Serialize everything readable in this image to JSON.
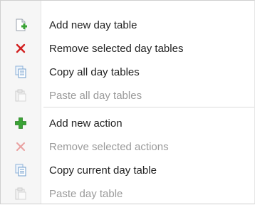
{
  "menu": {
    "items": [
      {
        "label": "Add new day table",
        "icon": "add-document-icon",
        "enabled": true
      },
      {
        "label": "Remove selected day tables",
        "icon": "red-x-icon",
        "enabled": true
      },
      {
        "label": "Copy all day tables",
        "icon": "copy-icon",
        "enabled": true
      },
      {
        "label": "Paste all day tables",
        "icon": "paste-icon",
        "enabled": false
      },
      {
        "label": "Add new action",
        "icon": "green-plus-icon",
        "enabled": true
      },
      {
        "label": "Remove selected actions",
        "icon": "red-x-icon",
        "enabled": false
      },
      {
        "label": "Copy current day table",
        "icon": "copy-icon",
        "enabled": true
      },
      {
        "label": "Paste day table",
        "icon": "paste-icon",
        "enabled": false
      }
    ]
  },
  "colors": {
    "text": "#222222",
    "disabled_text": "#9a9a9a",
    "remove_red": "#d21f1f",
    "add_green": "#3aa335"
  }
}
